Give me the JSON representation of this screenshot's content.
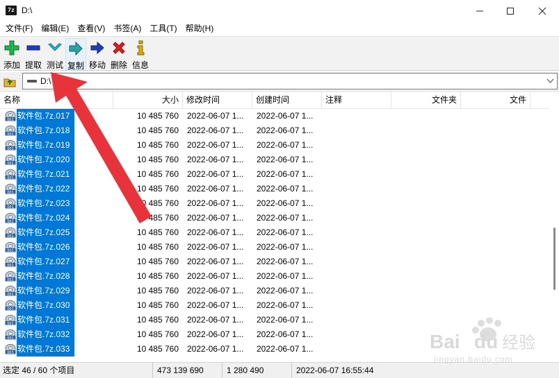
{
  "window": {
    "app_icon": "7z",
    "title": "D:\\",
    "controls": [
      "minimize-icon",
      "maximize-icon",
      "close-icon"
    ]
  },
  "menu": [
    "文件(F)",
    "编辑(E)",
    "查看(V)",
    "书签(A)",
    "工具(T)",
    "帮助(H)"
  ],
  "toolbar": {
    "buttons": [
      {
        "label": "添加",
        "icon": "add-icon",
        "color": "#22b14c"
      },
      {
        "label": "提取",
        "icon": "extract-icon",
        "color": "#1f3fbf"
      },
      {
        "label": "测试",
        "icon": "test-icon",
        "color": "#2ab7c6"
      },
      {
        "label": "复制",
        "icon": "copy-icon",
        "color": "#2aa3a3"
      },
      {
        "label": "移动",
        "icon": "move-icon",
        "color": "#1f3fbf"
      },
      {
        "label": "删除",
        "icon": "delete-icon",
        "color": "#e02020"
      },
      {
        "label": "信息",
        "icon": "info-icon",
        "color": "#e0b000"
      }
    ]
  },
  "address": {
    "path": "D:\\"
  },
  "columns": {
    "name": "名称",
    "size": "大小",
    "modified": "修改时间",
    "created": "创建时间",
    "comment": "注释",
    "folders": "文件夹",
    "files": "文件"
  },
  "rows": [
    {
      "name": "软件包.7z.017",
      "size": "10 485 760",
      "modified": "2022-06-07 1...",
      "created": "2022-06-07 1..."
    },
    {
      "name": "软件包.7z.018",
      "size": "10 485 760",
      "modified": "2022-06-07 1...",
      "created": "2022-06-07 1..."
    },
    {
      "name": "软件包.7z.019",
      "size": "10 485 760",
      "modified": "2022-06-07 1...",
      "created": "2022-06-07 1..."
    },
    {
      "name": "软件包.7z.020",
      "size": "10 485 760",
      "modified": "2022-06-07 1...",
      "created": "2022-06-07 1..."
    },
    {
      "name": "软件包.7z.021",
      "size": "10 485 760",
      "modified": "2022-06-07 1...",
      "created": "2022-06-07 1..."
    },
    {
      "name": "软件包.7z.022",
      "size": "10 485 760",
      "modified": "2022-06-07 1...",
      "created": "2022-06-07 1..."
    },
    {
      "name": "软件包.7z.023",
      "size": "10 485 760",
      "modified": "2022-06-07 1...",
      "created": "2022-06-07 1..."
    },
    {
      "name": "软件包.7z.024",
      "size": "10 485 760",
      "modified": "2022-06-07 1...",
      "created": "2022-06-07 1..."
    },
    {
      "name": "软件包.7z.025",
      "size": "10 485 760",
      "modified": "2022-06-07 1...",
      "created": "2022-06-07 1..."
    },
    {
      "name": "软件包.7z.026",
      "size": "10 485 760",
      "modified": "2022-06-07 1...",
      "created": "2022-06-07 1..."
    },
    {
      "name": "软件包.7z.027",
      "size": "10 485 760",
      "modified": "2022-06-07 1...",
      "created": "2022-06-07 1..."
    },
    {
      "name": "软件包.7z.028",
      "size": "10 485 760",
      "modified": "2022-06-07 1...",
      "created": "2022-06-07 1..."
    },
    {
      "name": "软件包.7z.029",
      "size": "10 485 760",
      "modified": "2022-06-07 1...",
      "created": "2022-06-07 1..."
    },
    {
      "name": "软件包.7z.030",
      "size": "10 485 760",
      "modified": "2022-06-07 1...",
      "created": "2022-06-07 1..."
    },
    {
      "name": "软件包.7z.031",
      "size": "10 485 760",
      "modified": "2022-06-07 1...",
      "created": "2022-06-07 1..."
    },
    {
      "name": "软件包.7z.032",
      "size": "10 485 760",
      "modified": "2022-06-07 1...",
      "created": "2022-06-07 1..."
    },
    {
      "name": "软件包.7z.033",
      "size": "10 485 760",
      "modified": "2022-06-07 1...",
      "created": "2022-06-07 1..."
    }
  ],
  "status": {
    "selection": "选定 46 / 60 个项目",
    "total_size": "473 139 690",
    "packed_size": "1 280 490",
    "timestamp": "2022-06-07 16:55:44"
  },
  "colors": {
    "selection": "#0078d7",
    "arrow": "#e8333b"
  },
  "watermark": {
    "brand": "Baidu经验",
    "url": "jingyan.baidu.com"
  }
}
